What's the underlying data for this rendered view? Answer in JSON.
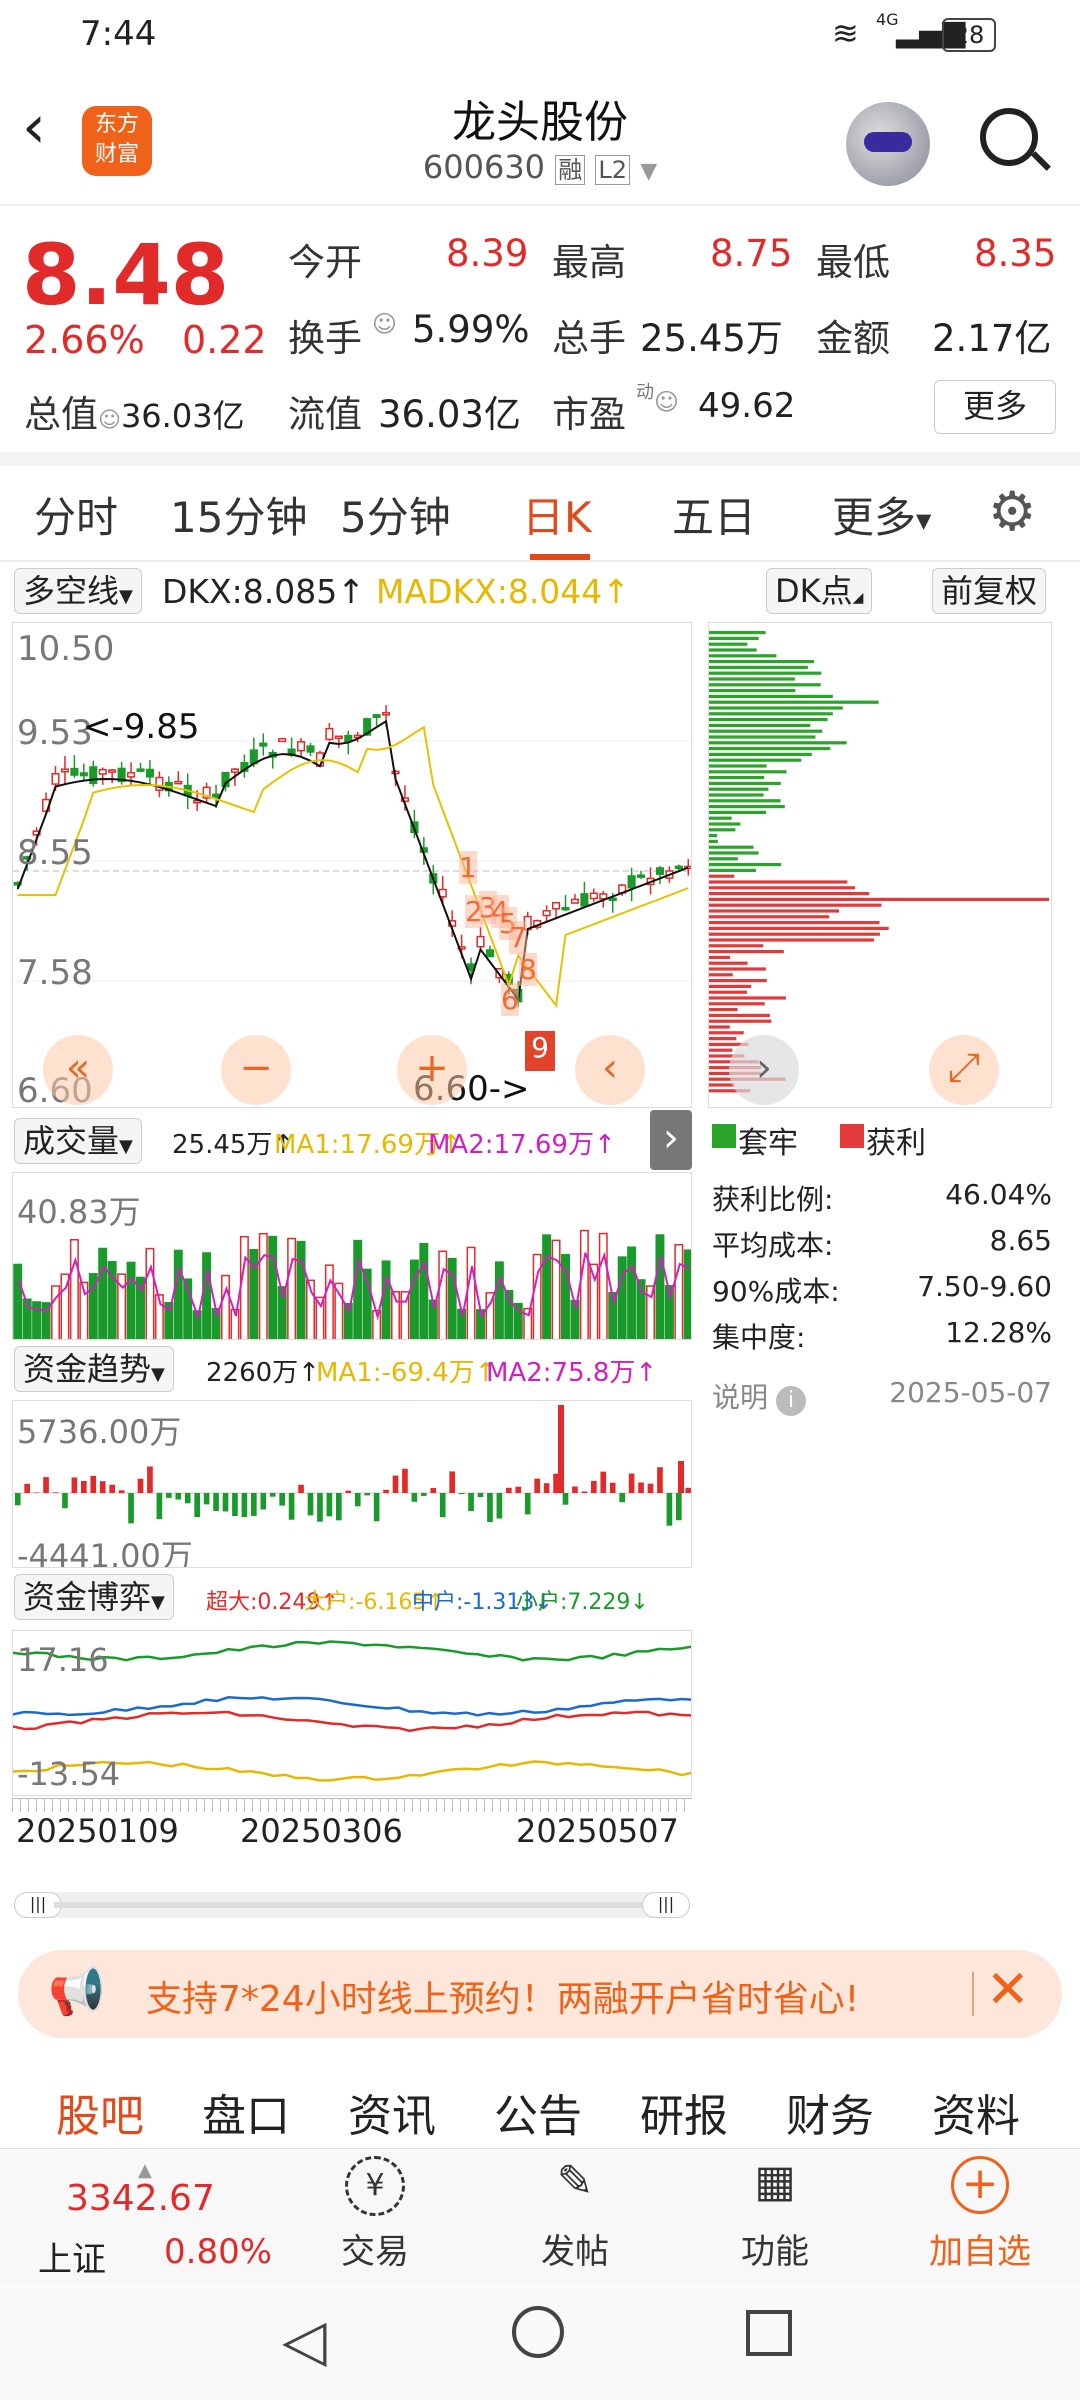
{
  "status": {
    "time": "7:44",
    "network": "4G",
    "battery": "28"
  },
  "header": {
    "name": "龙头股份",
    "code": "600630",
    "tag1": "融",
    "tag2": "L2",
    "logo_line1": "东方",
    "logo_line2": "财富"
  },
  "quote": {
    "price": "8.48",
    "pct": "2.66%",
    "chg": "0.22",
    "open_l": "今开",
    "open": "8.39",
    "high_l": "最高",
    "high": "8.75",
    "low_l": "最低",
    "low": "8.35",
    "turn_l": "换手",
    "turn": "5.99%",
    "vol_l": "总手",
    "vol": "25.45万",
    "amt_l": "金额",
    "amt": "2.17亿",
    "mcap_l": "总值",
    "mcap": "36.03亿",
    "float_l": "流值",
    "float": "36.03亿",
    "pe_l": "市盈",
    "pe_sup": "动",
    "pe": "49.62",
    "more": "更多"
  },
  "tabs": [
    "分时",
    "15分钟",
    "5分钟",
    "日K",
    "五日",
    "更多"
  ],
  "kline": {
    "indicator": "多空线",
    "dkx_label": "DKX:8.085↑",
    "madkx_label": "MADKX:8.044↑",
    "dk_btn": "DK点",
    "fq_btn": "前复权",
    "y_labels": [
      "10.50",
      "9.53",
      "8.55",
      "7.58",
      "6.60"
    ],
    "high_mark": "<-9.85",
    "low_mark": "6.60->",
    "nine": "9",
    "counts": [
      "1",
      "2",
      "3",
      "4",
      "5",
      "6",
      "7",
      "8"
    ]
  },
  "volume": {
    "indicator": "成交量",
    "val": "25.45万↑",
    "ma1": "MA1:17.69万↑",
    "ma2": "MA2:17.69万↑",
    "ymax": "40.83万"
  },
  "fund": {
    "indicator": "资金趋势",
    "val": "2260万↑",
    "ma1": "MA1:-69.4万↑",
    "ma2": "MA2:75.8万↑",
    "ymax": "5736.00万",
    "ymin": "-4441.00万"
  },
  "game": {
    "indicator": "资金博弈",
    "super": "超大:0.249↑",
    "big": "大户:-6.165↑",
    "mid": "中户:-1.313↓",
    "small": "小户:7.229↓",
    "ymax": "17.16",
    "ymin": "-13.54"
  },
  "dates": [
    "20250109",
    "20250306",
    "20250507"
  ],
  "chip": {
    "legend_trap": "套牢",
    "legend_profit": "获利",
    "rows": [
      {
        "k": "获利比例:",
        "v": "46.04%"
      },
      {
        "k": "平均成本:",
        "v": "8.65"
      },
      {
        "k": "90%成本:",
        "v": "7.50-9.60"
      },
      {
        "k": "集中度:",
        "v": "12.28%"
      }
    ],
    "note": "说明",
    "date": "2025-05-07"
  },
  "banner": {
    "text": "支持7*24小时线上预约！两融开户省时省心!"
  },
  "subtabs": [
    "股吧",
    "盘口",
    "资讯",
    "公告",
    "研报",
    "财务",
    "资料"
  ],
  "bottom": {
    "index_val": "3342.67",
    "index_name": "上证",
    "index_pct": "0.80%",
    "items": [
      "交易",
      "发帖",
      "功能",
      "加自选"
    ]
  },
  "colors": {
    "up": "#e12a2a",
    "down": "#1a9a2a",
    "accent": "#f0621a"
  }
}
